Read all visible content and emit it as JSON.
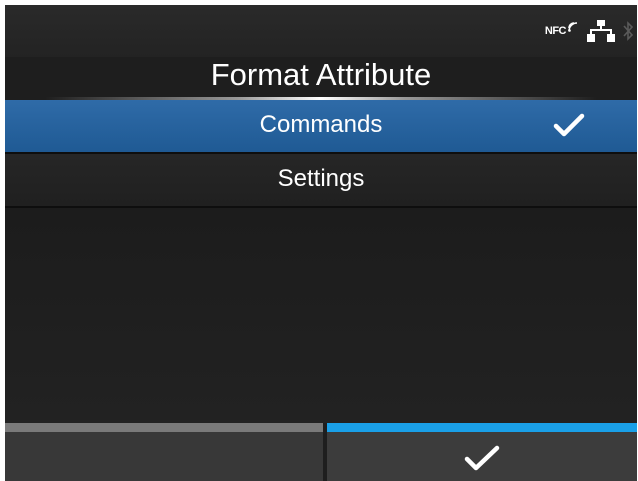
{
  "status": {
    "nfc_label": "NFC",
    "icons": [
      "nfc-icon",
      "network-icon",
      "bluetooth-icon"
    ]
  },
  "screen": {
    "title": "Format Attribute"
  },
  "menu": {
    "items": [
      {
        "label": "Commands",
        "selected": true
      },
      {
        "label": "Settings",
        "selected": false
      }
    ]
  },
  "softkeys": {
    "left": {
      "label": ""
    },
    "right": {
      "icon": "check-icon"
    }
  },
  "colors": {
    "background": "#1e1e1e",
    "selected_item": "#2a649f",
    "accent_blue": "#1aa0e8",
    "softkey_gray": "#7a7a7a"
  }
}
